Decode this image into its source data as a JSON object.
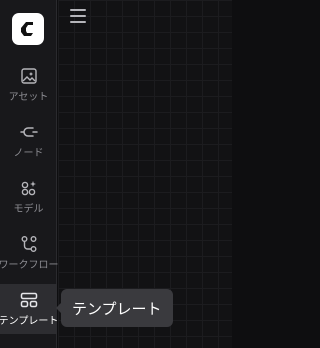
{
  "sidebar": {
    "logo": "c-logo-icon",
    "items": [
      {
        "label": "アセット",
        "icon": "image-sparkle-icon",
        "active": false
      },
      {
        "label": "ノード",
        "icon": "plug-icon",
        "active": false
      },
      {
        "label": "モデル",
        "icon": "grid-sparkle-icon",
        "active": false
      },
      {
        "label": "ワークフロー",
        "icon": "workflow-icon",
        "active": false
      },
      {
        "label": "テンプレート",
        "icon": "template-icon",
        "active": true
      }
    ]
  },
  "header": {
    "menu_icon": "hamburger-icon"
  },
  "tooltip": {
    "text": "テンプレート"
  },
  "colors": {
    "sidebar_bg": "#18181b",
    "canvas_bg": "#121214",
    "active_bg": "#2d2d31",
    "tooltip_bg": "#3a3a3e"
  }
}
